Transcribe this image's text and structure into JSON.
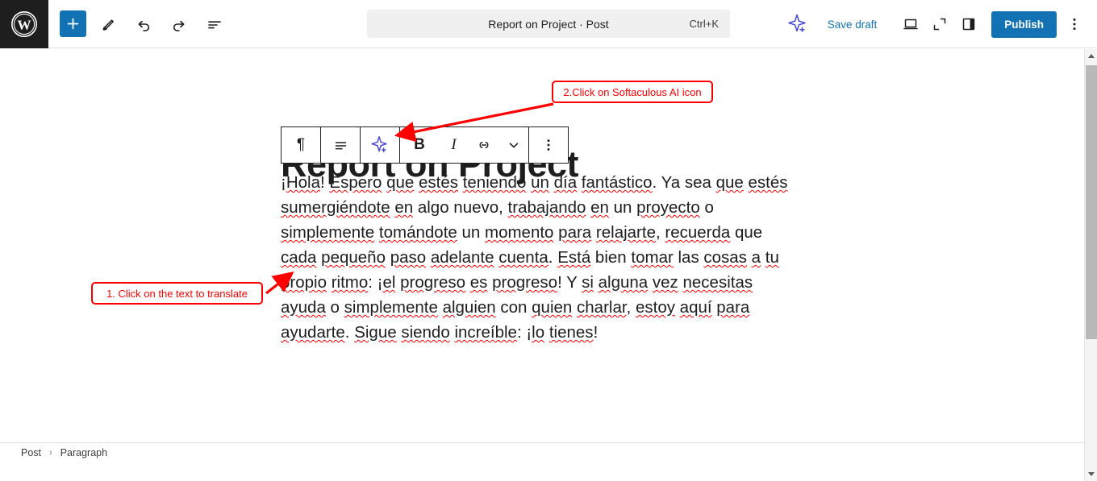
{
  "header": {
    "logo_icon": "wordpress-logo-icon",
    "add_block_label": "+",
    "tools": [
      {
        "name": "add-block-button",
        "icon": "plus-icon"
      },
      {
        "name": "edit-tools-button",
        "icon": "pencil-icon"
      },
      {
        "name": "undo-button",
        "icon": "undo-arrow-icon"
      },
      {
        "name": "redo-button",
        "icon": "redo-arrow-icon"
      },
      {
        "name": "document-overview-button",
        "icon": "list-view-icon"
      }
    ],
    "command_bar": {
      "title": "Report on Project · Post",
      "shortcut": "Ctrl+K"
    },
    "ai_icon": "softaculous-ai-star-icon",
    "save_draft_label": "Save draft",
    "view_icon": "desktop-preview-icon",
    "fullscreen_icon": "expand-icon",
    "sidebar_icon": "settings-sidebar-icon",
    "publish_label": "Publish",
    "options_icon": "vertical-dots-icon"
  },
  "editor": {
    "post_title": "Report on Project",
    "paragraph": "¡Hola! Espero que estés teniendo un día fantástico. Ya sea que estés sumergiéndote en algo nuevo, trabajando en un proyecto o simplemente tomándote un momento para relajarte, recuerda que cada pequeño paso adelante cuenta. Está bien tomar las cosas a tu propio ritmo: ¡el progreso es progreso! Y si alguna vez necesitas ayuda o simplemente alguien con quien charlar, estoy aquí para ayudarte. Sigue siendo increíble: ¡lo tienes!"
  },
  "block_toolbar": {
    "buttons": [
      {
        "name": "block-type-paragraph-button",
        "icon": "paragraph-pilcrow-icon",
        "glyph": "¶"
      },
      {
        "name": "align-text-button",
        "icon": "align-text-icon"
      },
      {
        "name": "softaculous-ai-button",
        "icon": "ai-star-plus-icon"
      },
      {
        "name": "bold-button",
        "icon": "bold-icon",
        "glyph": "B"
      },
      {
        "name": "italic-button",
        "icon": "italic-icon",
        "glyph": "I"
      },
      {
        "name": "link-button",
        "icon": "link-icon"
      },
      {
        "name": "more-formatting-button",
        "icon": "chevron-down-icon"
      },
      {
        "name": "block-options-button",
        "icon": "vertical-dots-icon"
      }
    ]
  },
  "annotations": [
    {
      "id": "anno1",
      "label": "1. Click on the text to translate"
    },
    {
      "id": "anno2",
      "label": "2.Click on Softaculous AI icon"
    }
  ],
  "footer": {
    "breadcrumb": [
      "Post",
      "Paragraph"
    ],
    "separator": "›"
  },
  "colors": {
    "accent_blue": "#1272b3",
    "ai_purple": "#4a4ad4",
    "annotation_red": "#ff0000",
    "spellcheck_red": "#ff0000",
    "dark": "#1e1e1e"
  },
  "scrollbar": {
    "up_icon": "scroll-up-arrow-icon",
    "down_icon": "scroll-down-arrow-icon"
  }
}
